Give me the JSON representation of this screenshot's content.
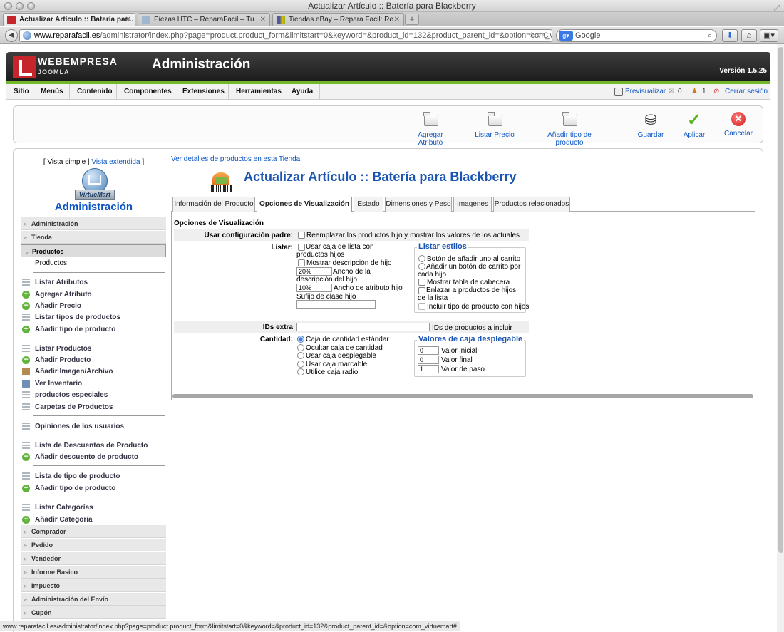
{
  "window": {
    "title": "Actualizar Artículo :: Batería para Blackberry"
  },
  "tabs": [
    {
      "label": "Actualizar Artículo :: Batería par..."
    },
    {
      "label": "Piezas HTC – ReparaFacil – Tu ..."
    },
    {
      "label": "Tiendas eBay – Repara Facil: Re..."
    }
  ],
  "nav": {
    "url_domain": "www.reparafacil.es",
    "url_path": "/administrator/index.php?page=product.product_form&limitstart=0&keyword=&product_id=132&product_parent_id=&option=com_vi",
    "search_placeholder": "Google",
    "search_engine": "g-icon"
  },
  "joomla": {
    "brand": "WEBEMPRESA",
    "brand_sub": "JOOMLA",
    "title": "Administración",
    "version": "Versión 1.5.25",
    "menu": [
      "Sitio",
      "Menús",
      "Contenido",
      "Componentes",
      "Extensiones",
      "Herramientas",
      "Ayuda"
    ],
    "preview": "Previsualizar",
    "messages_count": "0",
    "users_count": "1",
    "logout": "Cerrar sesión"
  },
  "toolbar": {
    "add_attribute": "Agregar Atributo",
    "list_price": "Listar Precio",
    "add_product_type": "Añadir tipo de producto",
    "save": "Guardar",
    "apply": "Aplicar",
    "cancel": "Cancelar"
  },
  "sidebar": {
    "view_simple": "[ Vista simple |",
    "view_extended": "Vista extendida",
    "view_close": "]",
    "logo_text": "VirtueMart",
    "admin_title": "Administración",
    "sections_top": [
      "Administración",
      "Tienda"
    ],
    "open_section": "Productos",
    "open_sub": "Productos",
    "group1": [
      "Listar Atributos",
      "Agregar Atributo",
      "Añadir Precio",
      "Listar tipos de productos",
      "Añadir tipo de producto"
    ],
    "group2": [
      "Listar Productos",
      "Añadir Producto",
      "Añadir Imagen/Archivo",
      "Ver Inventario",
      "productos especiales",
      "Carpetas de Productos"
    ],
    "group3": [
      "Opiniones de los usuarios"
    ],
    "group4": [
      "Lista de Descuentos de Producto",
      "Añadir descuento de producto"
    ],
    "group5": [
      "Lista de tipo de producto",
      "Añadir tipo de producto"
    ],
    "group6": [
      "Listar Categorías",
      "Añadir Categoría"
    ],
    "sections_bottom": [
      "Comprador",
      "Pedido",
      "Vendedor",
      "Informe Basico",
      "Impuesto",
      "Administración del Envío",
      "Cupón"
    ]
  },
  "content": {
    "detail_link": "Ver detalles de productos en esta Tienda",
    "page_title": "Actualizar Artículo :: Batería para Blackberry",
    "tabs": [
      "Información del Producto",
      "Opciones de Visualización",
      "Estado",
      "Dimensiones y Peso",
      "Imagenes",
      "Productos relacionados"
    ],
    "section_title": "Opciones de Visualización",
    "parent_config_label": "Usar configuración padre:",
    "parent_config_text": "Reemplazar los productos hijo y mostrar los valores de los actuales",
    "list_label": "Listar:",
    "use_list_box": "Usar caja de lista con productos hijos",
    "show_child_desc": "Mostrar descripción de hijo",
    "desc_width_value": "20%",
    "desc_width_label": "Ancho de la descripción del hijo",
    "attr_width_value": "10%",
    "attr_width_label": "Ancho de atributo hijo",
    "class_suffix_label": "Sufijo de clase hijo",
    "list_styles_legend": "Listar estilos",
    "styles": [
      "Botón de añadir uno al carrito",
      "Añadir un botón de carrito por cada hijo"
    ],
    "styles_checks": [
      "Mostrar tabla de cabecera",
      "Enlazar a productos de hijos de la lista",
      "Incluir tipo de producto con hijos"
    ],
    "extra_ids_label": "IDs extra",
    "extra_ids_hint": "IDs de productos a incluir",
    "quantity_label": "Cantidad:",
    "quantity_options": [
      "Caja de cantidad estándar",
      "Ocultar caja de cantidad",
      "Usar caja desplegable",
      "Usar caja marcable",
      "Utilice caja radio"
    ],
    "dropdown_legend": "Valores de caja desplegable",
    "initial_value": "0",
    "initial_label": "Valor inicial",
    "final_value": "0",
    "final_label": "Valor final",
    "step_value": "1",
    "step_label": "Valor de paso"
  },
  "status_url": "www.reparafacil.es/administrator/index.php?page=product.product_form&limitstart=0&keyword=&product_id=132&product_parent_id=&option=com_virtuemart#"
}
